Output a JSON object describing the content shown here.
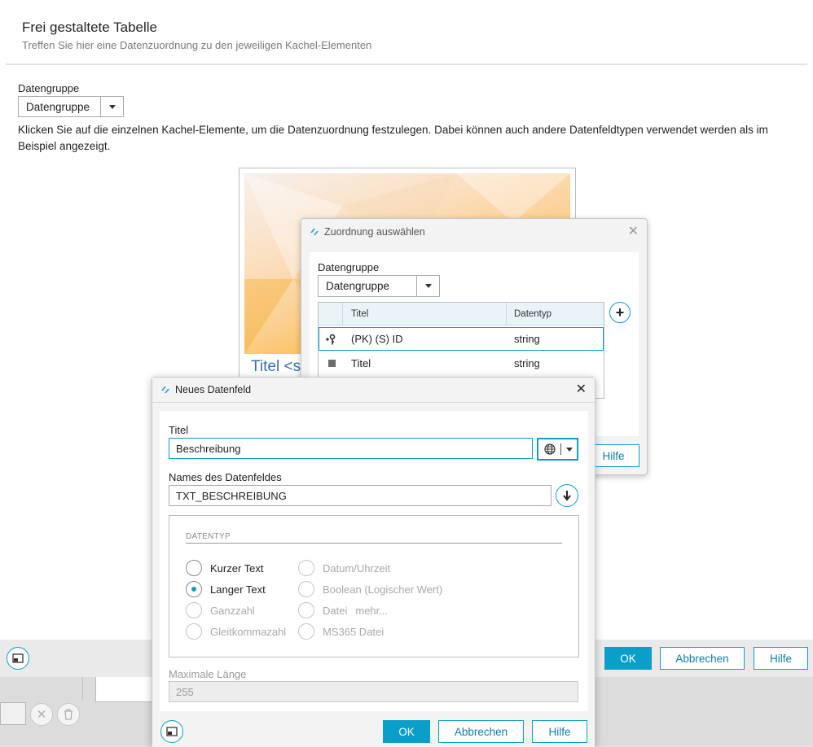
{
  "main": {
    "title": "Frei gestaltete Tabelle",
    "subtitle": "Treffen Sie hier eine Datenzuordnung zu den jeweiligen Kachel-Elementen",
    "group_label": "Datengruppe",
    "group_value": "Datengruppe",
    "info": "Klicken Sie auf die einzelnen Kachel-Elemente, um die Datenzuordnung festzulegen. Dabei können auch andere Datenfeldtypen verwendet werden als im Beispiel angezeigt.",
    "tile_title": "Titel <s",
    "ok": "OK",
    "cancel": "Abbrechen",
    "help": "Hilfe"
  },
  "zuordnung": {
    "title": "Zuordnung auswählen",
    "group_label": "Datengruppe",
    "group_value": "Datengruppe",
    "columns": [
      "Titel",
      "Datentyp"
    ],
    "rows": [
      {
        "title": "(PK) (S) ID",
        "type": "string"
      },
      {
        "title": "Titel",
        "type": "string"
      }
    ],
    "help": "Hilfe"
  },
  "neues": {
    "title": "Neues Datenfeld",
    "titel_label": "Titel",
    "titel_value": "Beschreibung",
    "name_label": "Names des Datenfeldes",
    "name_value": "TXT_BESCHREIBUNG",
    "datentyp_legend": "DATENTYP",
    "types_left": [
      {
        "label": "Kurzer Text",
        "checked": false,
        "enabled": true
      },
      {
        "label": "Langer Text",
        "checked": true,
        "enabled": true
      },
      {
        "label": "Ganzzahl",
        "checked": false,
        "enabled": false
      },
      {
        "label": "Gleitkommazahl",
        "checked": false,
        "enabled": false
      }
    ],
    "types_right": [
      {
        "label": "Datum/Uhrzeit",
        "enabled": false
      },
      {
        "label": "Boolean (Logischer Wert)",
        "enabled": false
      },
      {
        "label": "Datei",
        "enabled": false
      },
      {
        "label": "MS365 Datei",
        "enabled": false
      }
    ],
    "more_link": "mehr...",
    "max_label": "Maximale Länge",
    "max_value": "255",
    "ok": "OK",
    "cancel": "Abbrechen",
    "help": "Hilfe"
  },
  "colors": {
    "accent": "#0a9fc9",
    "tile_title": "#3a6fb5"
  }
}
